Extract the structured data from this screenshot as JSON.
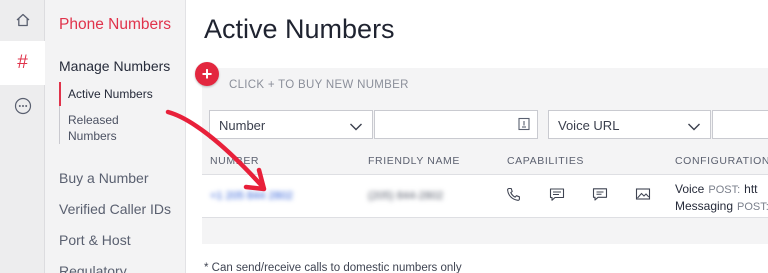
{
  "rail": {
    "items": [
      {
        "icon": "home-icon"
      },
      {
        "icon": "hash-icon",
        "label": "#"
      },
      {
        "icon": "more-icon"
      }
    ]
  },
  "sidebar": {
    "title": "Phone Numbers",
    "section": "Manage Numbers",
    "sub_items": [
      "Active Numbers",
      "Released Numbers"
    ],
    "items": [
      "Buy a Number",
      "Verified Caller IDs",
      "Port & Host",
      "Regulatory"
    ]
  },
  "main": {
    "title": "Active Numbers",
    "add_symbol": "+",
    "buy_text": "CLICK + TO BUY NEW NUMBER",
    "filters": {
      "select1": "Number",
      "select2": "Voice URL"
    },
    "columns": [
      "NUMBER",
      "FRIENDLY NAME",
      "CAPABILITIES",
      "CONFIGURATION"
    ],
    "rows": [
      {
        "number": "+1 205 844 2802",
        "friendly_name": "(205) 844-2802",
        "capabilities": [
          "voice-icon",
          "sms-icon",
          "mms-icon",
          "fax-icon"
        ],
        "config": [
          {
            "label": "Voice",
            "method": "POST:",
            "url": "htt"
          },
          {
            "label": "Messaging",
            "method": "POST:",
            "url": ""
          }
        ]
      }
    ],
    "footnote": "* Can send/receive calls to domestic numbers only"
  },
  "colors": {
    "accent": "#e0334b",
    "link": "#2a5bd7",
    "annotation_arrow": "#e8203a"
  }
}
